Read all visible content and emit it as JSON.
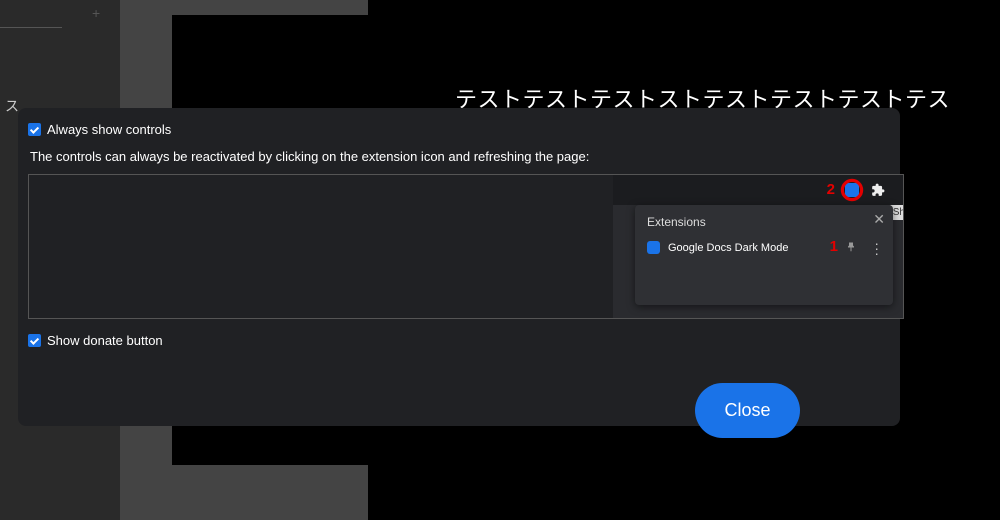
{
  "background": {
    "plus_icon": "+",
    "doc_title": "テストテストテストストテストテストテストテス",
    "sidebar_char": "ス"
  },
  "modal": {
    "always_show_label": "Always show controls",
    "hint_text": "The controls can always be reactivated by clicking on the extension icon and refreshing the page:",
    "show_donate_label": "Show donate button",
    "close_label": "Close"
  },
  "illustration": {
    "annotation_1": "1",
    "annotation_2": "2",
    "popup_title": "Extensions",
    "extension_name": "Google Docs Dark Mode",
    "close_x": "✕",
    "sh_label": "Sh"
  }
}
